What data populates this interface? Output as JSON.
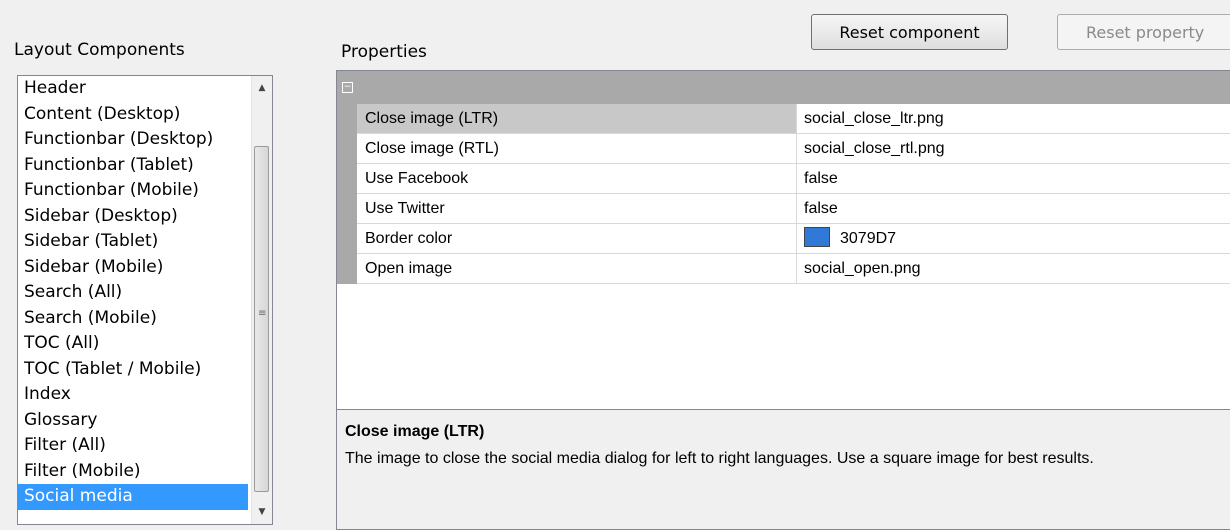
{
  "layout_components": {
    "label": "Layout Components",
    "items": [
      "Header",
      "Content (Desktop)",
      "Functionbar (Desktop)",
      "Functionbar (Tablet)",
      "Functionbar (Mobile)",
      "Sidebar (Desktop)",
      "Sidebar (Tablet)",
      "Sidebar (Mobile)",
      "Search (All)",
      "Search (Mobile)",
      "TOC (All)",
      "TOC (Tablet / Mobile)",
      "Index",
      "Glossary",
      "Filter (All)",
      "Filter (Mobile)",
      "Social media"
    ],
    "selected": "Social media"
  },
  "properties": {
    "label": "Properties",
    "collapse_glyph": "−",
    "rows": [
      {
        "name": "Close image (LTR)",
        "value": "social_close_ltr.png"
      },
      {
        "name": "Close image (RTL)",
        "value": "social_close_rtl.png"
      },
      {
        "name": "Use Facebook",
        "value": "false"
      },
      {
        "name": "Use Twitter",
        "value": "false"
      },
      {
        "name": "Border color",
        "value": "3079D7",
        "swatch": "#3079D7"
      },
      {
        "name": "Open image",
        "value": "social_open.png"
      }
    ],
    "selected_row": "Close image (LTR)"
  },
  "buttons": {
    "reset_component": "Reset component",
    "reset_property": "Reset property"
  },
  "description": {
    "title": "Close image (LTR)",
    "text": "The image to close the social media dialog for left to right languages. Use a square image for best results."
  },
  "colors": {
    "selection": "#3399ff",
    "category_bar": "#a9a9a9"
  }
}
